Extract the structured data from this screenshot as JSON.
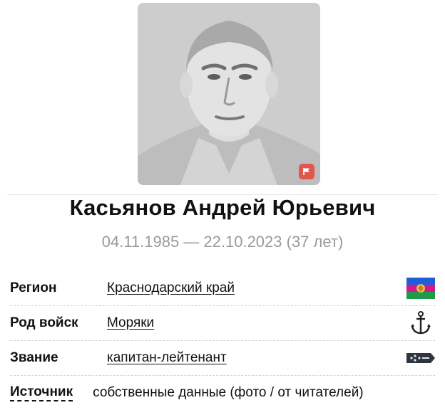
{
  "person": {
    "name": "Касьянов Андрей Юрьевич",
    "dates": "04.11.1985 — 22.10.2023 (37 лет)"
  },
  "info": {
    "region": {
      "label": "Регион",
      "value": "Краснодарский край",
      "icon": "krasnodar-flag-icon"
    },
    "branch": {
      "label": "Род войск",
      "value": "Моряки",
      "icon": "anchor-icon"
    },
    "rank": {
      "label": "Звание",
      "value": "капитан-лейтенант",
      "icon": "shoulder-strap-icon"
    },
    "source": {
      "label": "Источник",
      "value": "собственные данные (фото / от читателей)"
    }
  },
  "colors": {
    "flag_badge": "#e2574c",
    "dates_text": "#9a9a9a",
    "krasnodar_blue": "#1e5ed8",
    "krasnodar_magenta": "#d6178a",
    "krasnodar_green": "#1f9a4a"
  }
}
